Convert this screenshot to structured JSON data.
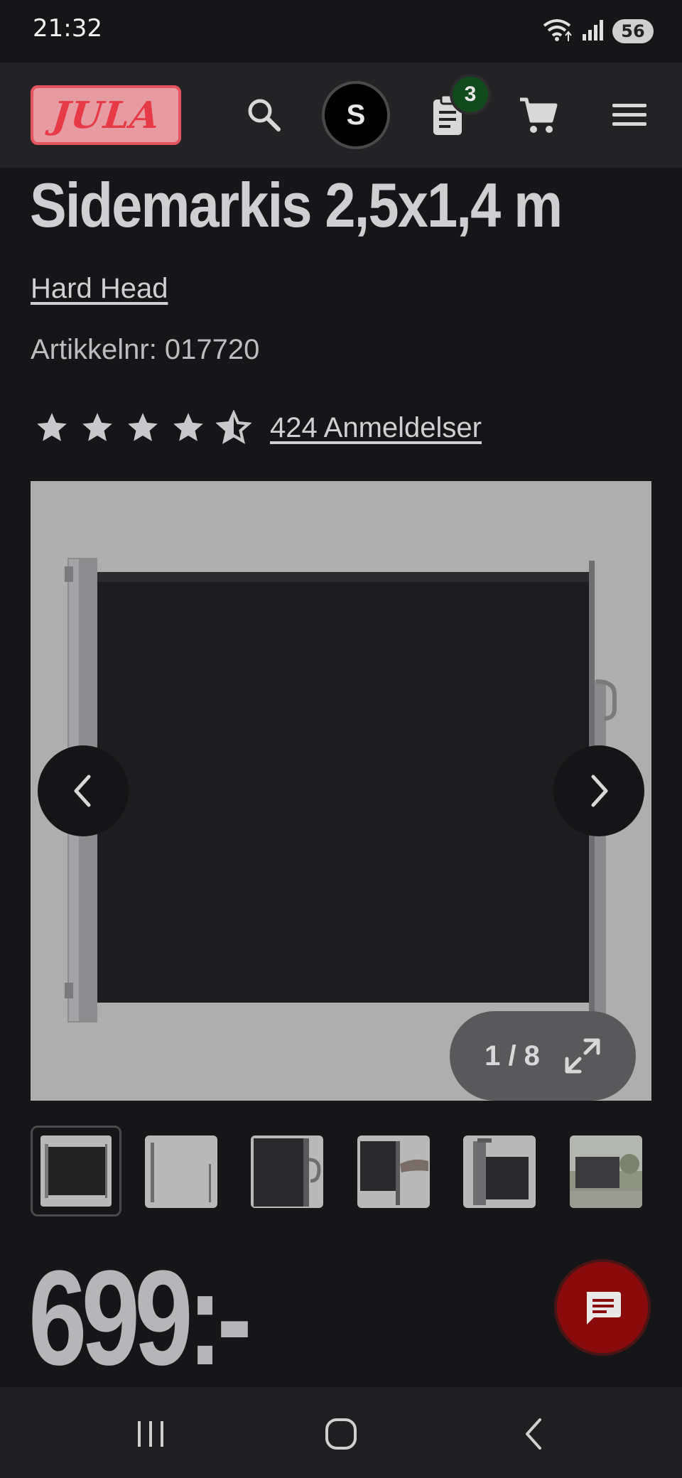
{
  "status_bar": {
    "time": "21:32",
    "battery": "56",
    "icons": [
      "wifi-icon",
      "signal-icon",
      "battery-icon"
    ]
  },
  "header": {
    "logo_text": "JULA",
    "avatar_initial": "S",
    "list_badge": "3",
    "icons": [
      "search-icon",
      "clipboard-list-icon",
      "cart-icon",
      "hamburger-menu-icon"
    ]
  },
  "product": {
    "title": "Sidemarkis 2,5x1,4 m",
    "brand": "Hard Head",
    "article_number": "Artikkelnr: 017720",
    "rating": 4.5,
    "reviews": "424 Anmeldelser",
    "price": "699:-"
  },
  "gallery": {
    "counter": "1 / 8",
    "current": 1,
    "total": 8,
    "thumbnail_count": 6
  },
  "colors": {
    "brand_red": "#e3545e",
    "badge_green": "#114a1c",
    "chat_red": "#8a0b0b",
    "background": "#161618"
  }
}
